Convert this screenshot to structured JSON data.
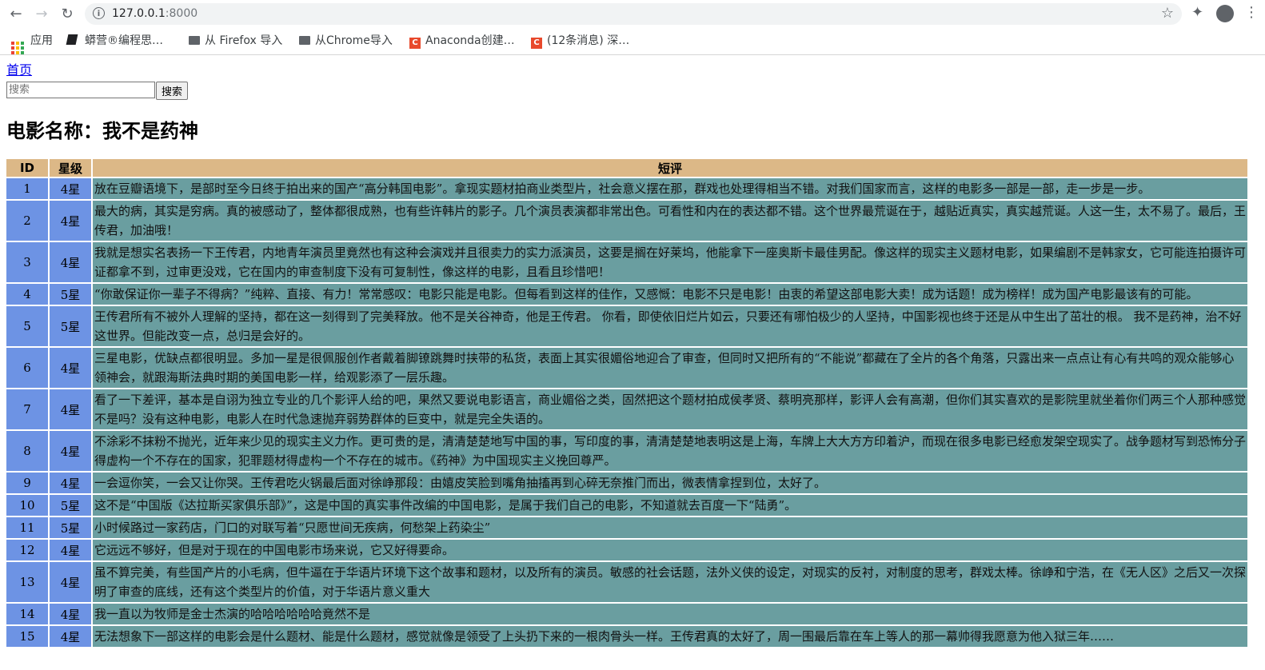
{
  "browser": {
    "url_host": "127.0.0.1",
    "url_port": ":8000",
    "bookmarks": [
      {
        "label": "应用",
        "icon": "apps-grid-icon"
      },
      {
        "label": "蟒营®编程思…",
        "icon": "book-icon"
      },
      {
        "label": "从 Firefox 导入",
        "icon": "folder-icon"
      },
      {
        "label": "从Chrome导入",
        "icon": "folder-icon"
      },
      {
        "label": "Anaconda创建…",
        "icon": "csdn-icon"
      },
      {
        "label": "(12条消息) 深…",
        "icon": "csdn-icon"
      }
    ]
  },
  "nav": {
    "home_label": "首页"
  },
  "search": {
    "placeholder": "搜索",
    "button_label": "搜索"
  },
  "movie": {
    "title": "电影名称：我不是药神"
  },
  "table": {
    "headers": [
      "ID",
      "星级",
      "短评"
    ],
    "rows": [
      {
        "id": "1",
        "star": "4星",
        "comment": "放在豆瓣语境下，是部时至今日终于拍出来的国产“高分韩国电影”。拿现实题材拍商业类型片，社会意义摆在那，群戏也处理得相当不错。对我们国家而言，这样的电影多一部是一部，走一步是一步。"
      },
      {
        "id": "2",
        "star": "4星",
        "comment": "最大的病，其实是穷病。真的被感动了，整体都很成熟，也有些许韩片的影子。几个演员表演都非常出色。可看性和内在的表达都不错。这个世界最荒诞在于，越贴近真实，真实越荒诞。人这一生，太不易了。最后，王传君，加油哦！"
      },
      {
        "id": "3",
        "star": "4星",
        "comment": "我就是想实名表扬一下王传君，内地青年演员里竟然也有这种会演戏并且很卖力的实力派演员，这要是搁在好莱坞，他能拿下一座奥斯卡最佳男配。像这样的现实主义题材电影，如果编剧不是韩家女，它可能连拍摄许可证都拿不到，过审更没戏，它在国内的审查制度下没有可复制性，像这样的电影，且看且珍惜吧！"
      },
      {
        "id": "4",
        "star": "5星",
        "comment": "“你敢保证你一辈子不得病？”纯粹、直接、有力！常常感叹：电影只能是电影。但每看到这样的佳作，又感慨：电影不只是电影！由衷的希望这部电影大卖！成为话题！成为榜样！成为国产电影最该有的可能。"
      },
      {
        "id": "5",
        "star": "5星",
        "comment": "王传君所有不被外人理解的坚持，都在这一刻得到了完美释放。他不是关谷神奇，他是王传君。 你看，即使依旧烂片如云，只要还有哪怕极少的人坚持，中国影视也终于还是从中生出了茁壮的根。 我不是药神，治不好这世界。但能改变一点，总归是会好的。"
      },
      {
        "id": "6",
        "star": "4星",
        "comment": "三星电影，优缺点都很明显。多加一星是很佩服创作者戴着脚镣跳舞时挟带的私货，表面上其实很媚俗地迎合了审查，但同时又把所有的“不能说”都藏在了全片的各个角落，只露出来一点点让有心有共鸣的观众能够心领神会，就跟海斯法典时期的美国电影一样，给观影添了一层乐趣。"
      },
      {
        "id": "7",
        "star": "4星",
        "comment": "看了一下差评，基本是自诩为独立专业的几个影评人给的吧，果然又要说电影语言，商业媚俗之类，固然把这个题材拍成侯孝贤、蔡明亮那样，影评人会有高潮，但你们其实喜欢的是影院里就坐着你们两三个人那种感觉不是吗？没有这种电影，电影人在时代急速抛弃弱势群体的巨变中，就是完全失语的。"
      },
      {
        "id": "8",
        "star": "4星",
        "comment": "不涂彩不抹粉不抛光，近年来少见的现实主义力作。更可贵的是，清清楚楚地写中国的事，写印度的事，清清楚楚地表明这是上海，车牌上大大方方印着沪，而现在很多电影已经愈发架空现实了。战争题材写到恐怖分子得虚构一个不存在的国家，犯罪题材得虚构一个不存在的城市。《药神》为中国现实主义挽回尊严。"
      },
      {
        "id": "9",
        "star": "4星",
        "comment": "一会逗你笑，一会又让你哭。王传君吃火锅最后面对徐峥那段：由嬉皮笑脸到嘴角抽搐再到心碎无奈推门而出，微表情拿捏到位，太好了。"
      },
      {
        "id": "10",
        "star": "5星",
        "comment": "这不是“中国版《达拉斯买家俱乐部》”，这是中国的真实事件改编的中国电影，是属于我们自己的电影，不知道就去百度一下“陆勇”。"
      },
      {
        "id": "11",
        "star": "5星",
        "comment": "小时候路过一家药店，门口的对联写着“只愿世间无疾病，何愁架上药染尘”"
      },
      {
        "id": "12",
        "star": "4星",
        "comment": "它远远不够好，但是对于现在的中国电影市场来说，它又好得要命。"
      },
      {
        "id": "13",
        "star": "4星",
        "comment": "虽不算完美，有些国产片的小毛病，但牛逼在于华语片环境下这个故事和题材，以及所有的演员。敏感的社会话题，法外义侠的设定，对现实的反衬，对制度的思考，群戏太棒。徐峥和宁浩，在《无人区》之后又一次探明了审查的底线，还有这个类型片的价值，对于华语片意义重大"
      },
      {
        "id": "14",
        "star": "4星",
        "comment": "我一直以为牧师是金士杰演的哈哈哈哈哈哈竟然不是"
      },
      {
        "id": "15",
        "star": "4星",
        "comment": "无法想象下一部这样的电影会是什么题材、能是什么题材，感觉就像是领受了上头扔下来的一根肉骨头一样。王传君真的太好了，周一围最后靠在车上等人的那一幕帅得我愿意为他入狱三年……"
      }
    ]
  }
}
